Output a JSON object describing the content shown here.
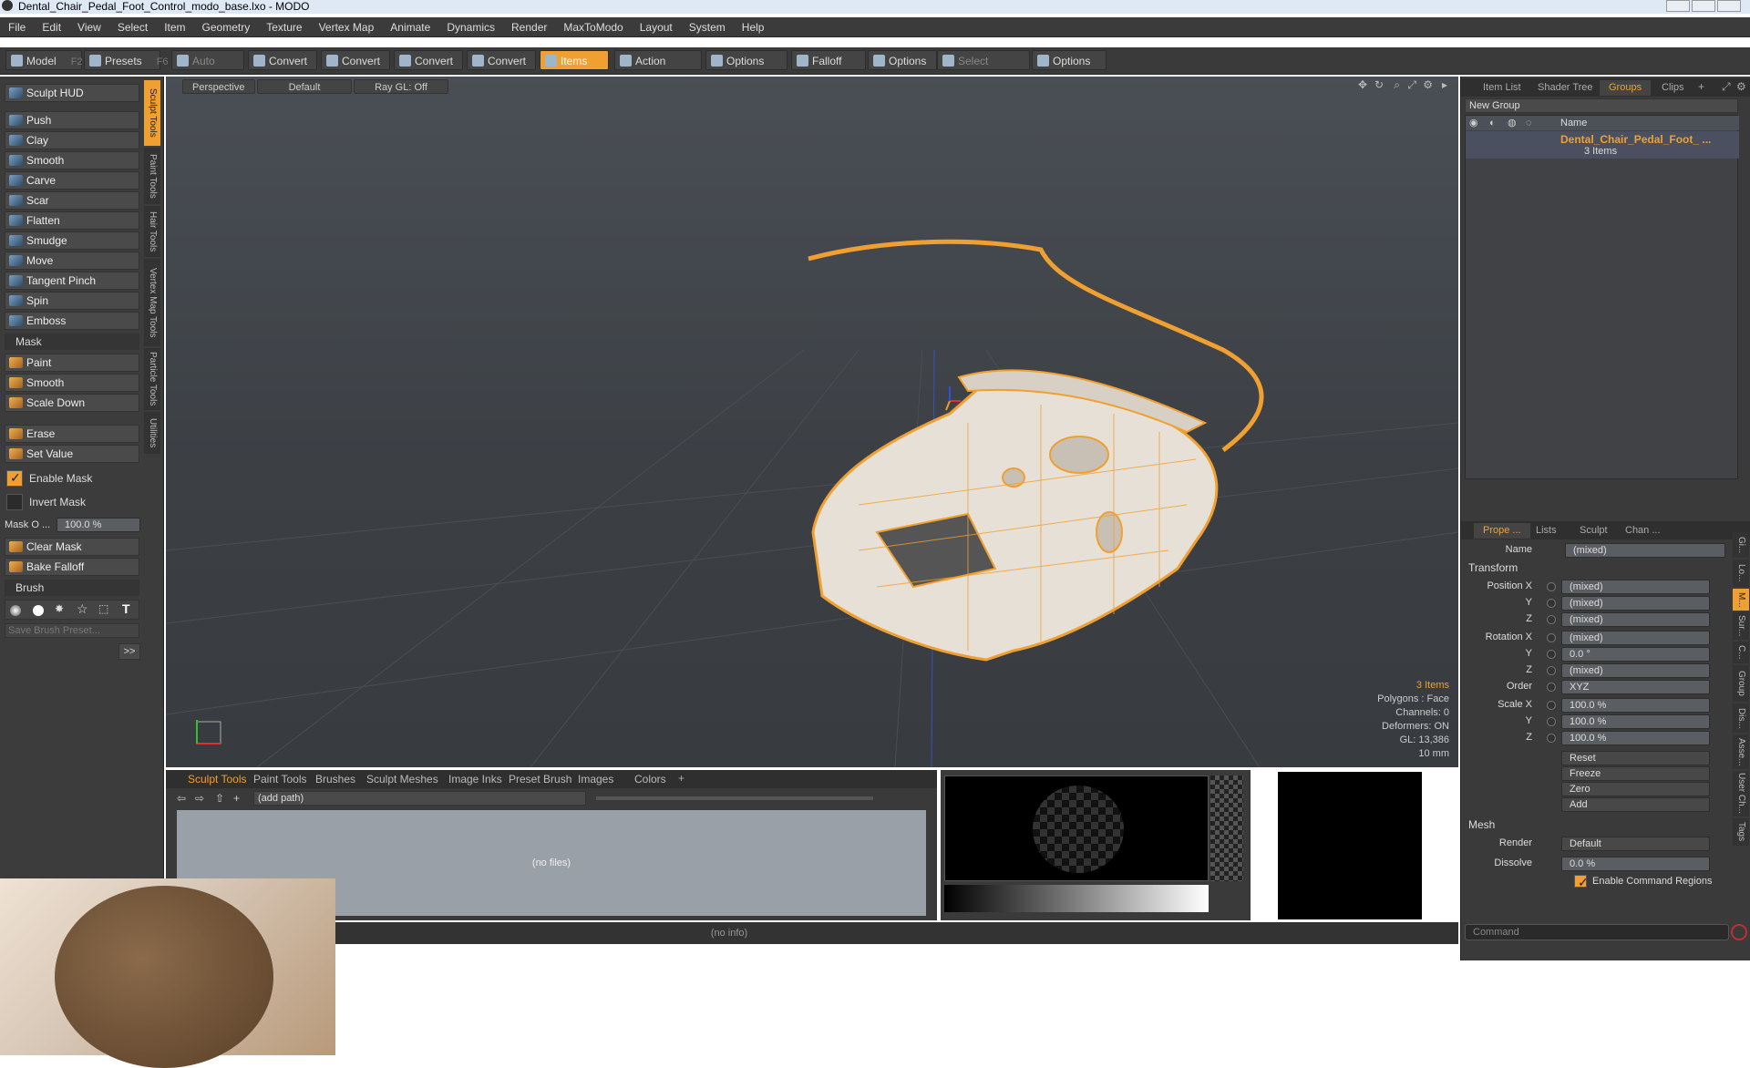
{
  "title": "Dental_Chair_Pedal_Foot_Control_modo_base.lxo - MODO",
  "menu": [
    "File",
    "Edit",
    "View",
    "Select",
    "Item",
    "Geometry",
    "Texture",
    "Vertex Map",
    "Animate",
    "Dynamics",
    "Render",
    "MaxToModo",
    "Layout",
    "System",
    "Help"
  ],
  "toolbar": {
    "model": "Model",
    "model_key": "F2",
    "presets": "Presets",
    "presets_key": "F6",
    "auto_select": "Auto Select",
    "convert": "Convert",
    "items": "Items",
    "action_center": "Action Center",
    "options": "Options",
    "falloff": "Falloff",
    "select_through": "Select Through"
  },
  "left": {
    "hud": "Sculpt HUD",
    "tools": [
      "Push",
      "Clay",
      "Smooth",
      "Carve",
      "Scar",
      "Flatten",
      "Smudge",
      "Move",
      "Tangent Pinch",
      "Spin",
      "Emboss"
    ],
    "mask_header": "Mask",
    "mask_tools": [
      "Paint",
      "Smooth",
      "Scale Down"
    ],
    "erase": "Erase",
    "set_value": "Set Value",
    "enable_mask": "Enable Mask",
    "invert_mask": "Invert Mask",
    "mask_opacity_label": "Mask O ...",
    "mask_opacity_value": "100.0 %",
    "clear_mask": "Clear Mask",
    "bake_falloff": "Bake Falloff",
    "brush_header": "Brush",
    "save_brush": "Save Brush Preset...",
    "more": ">>"
  },
  "side_tabs": [
    "Sculpt Tools",
    "Paint Tools",
    "Hair Tools",
    "Vertex Map Tools",
    "Particle Tools",
    "Utilities"
  ],
  "viewport": {
    "view": "Perspective",
    "style": "Default",
    "raygl": "Ray GL: Off",
    "info_items": "3 Items",
    "info_polys": "Polygons : Face",
    "info_channels": "Channels: 0",
    "info_deformers": "Deformers: ON",
    "info_gl": "GL: 13,386",
    "info_scale": "10 mm"
  },
  "right": {
    "top_tabs": [
      "Item List",
      "Shader Tree",
      "Groups",
      "Clips"
    ],
    "new_group": "New Group",
    "name_col": "Name",
    "group_name": "Dental_Chair_Pedal_Foot_ ...",
    "group_count": "3 Items",
    "prop_tabs": [
      "Prope ...",
      "Lists",
      "Sculpt",
      "Chan ..."
    ],
    "name_label": "Name",
    "name_value": "(mixed)",
    "transform": "Transform",
    "position_label": "Position X",
    "rotation_label": "Rotation X",
    "scale_label": "Scale X",
    "y": "Y",
    "z": "Z",
    "pos_x": "(mixed)",
    "pos_y": "(mixed)",
    "pos_z": "(mixed)",
    "rot_x": "(mixed)",
    "rot_y": "0.0 °",
    "rot_z": "(mixed)",
    "order_label": "Order",
    "order": "XYZ",
    "scl_x": "100.0 %",
    "scl_y": "100.0 %",
    "scl_z": "100.0 %",
    "reset": "Reset",
    "freeze": "Freeze",
    "zero": "Zero",
    "add": "Add",
    "mesh": "Mesh",
    "render_label": "Render",
    "render": "Default",
    "dissolve_label": "Dissolve",
    "dissolve": "0.0 %",
    "enable_cmd": "Enable Command Regions",
    "command": "Command",
    "vtabs": [
      "Gi...",
      "Lo...",
      "M...",
      "Sur...",
      "C...",
      "Group",
      "Dis...",
      "Asse...",
      "User Ch...",
      "Tags"
    ]
  },
  "bottom": {
    "tabs": [
      "Sculpt Tools",
      "Paint Tools",
      "Brushes",
      "Sculpt Meshes",
      "Image Inks",
      "Preset Brush",
      "Images",
      "Colors"
    ],
    "path": "(add path)",
    "no_files": "(no files)"
  },
  "status": "(no info)"
}
